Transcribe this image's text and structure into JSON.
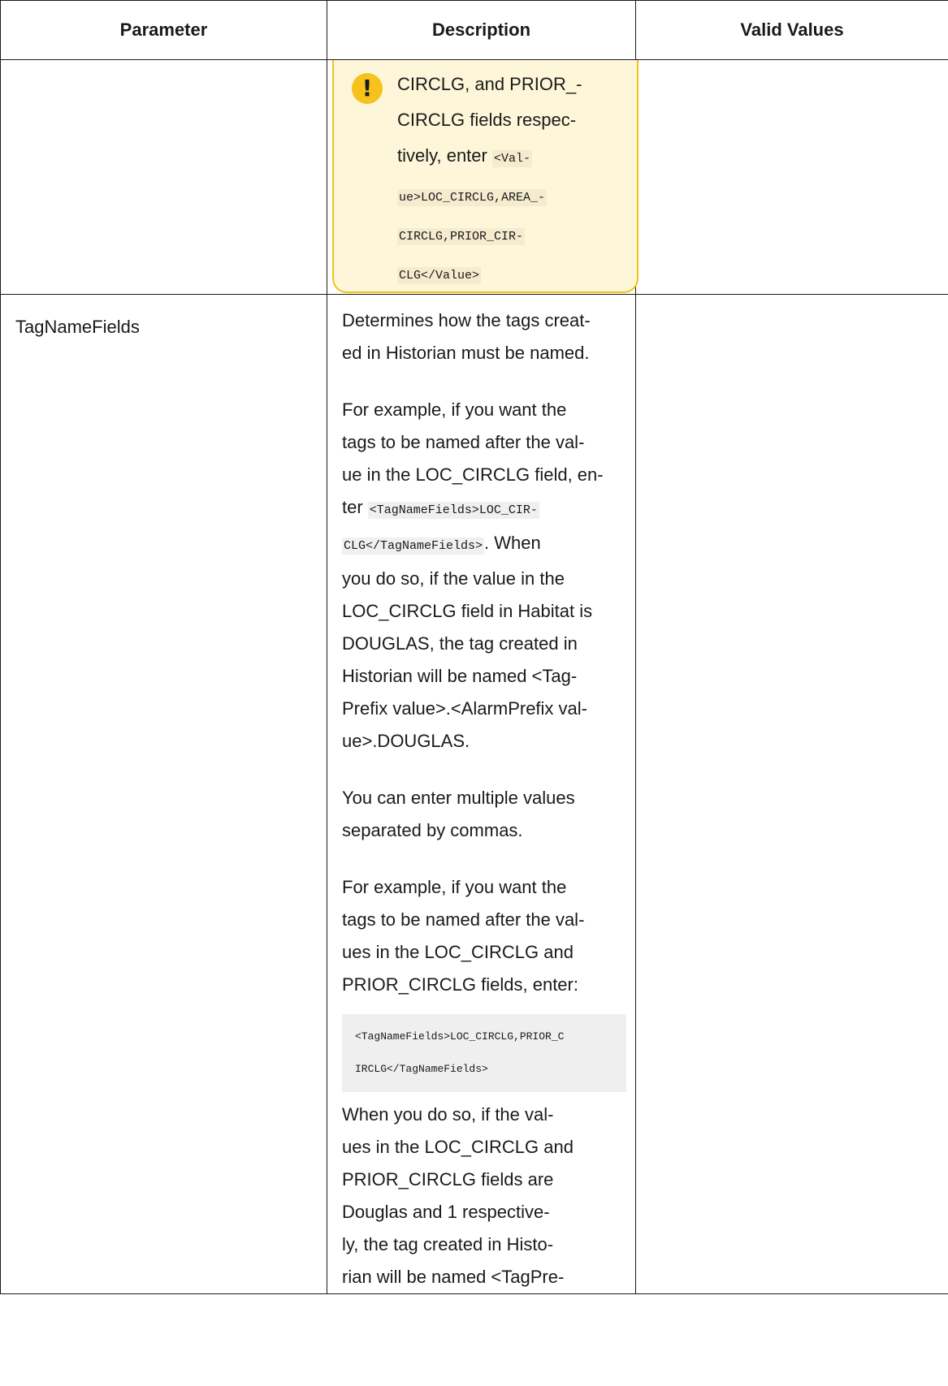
{
  "table": {
    "headers": {
      "parameter": "Parameter",
      "description": "Description",
      "valid_values": "Valid Values"
    },
    "note_row": {
      "icon": "exclamation-icon",
      "lines": [
        "CIRCLG, and PRIOR_-",
        "CIRCLG fields respec-"
      ],
      "line3_prefix": "tively, enter ",
      "code_lines": [
        "<Val-",
        "ue>LOC_CIRCLG,AREA_-",
        "CIRCLG,PRIOR_CIR-",
        "CLG</Value>"
      ]
    },
    "tagname_row": {
      "parameter": "TagNameFields",
      "p1_lines": [
        "Determines how the tags creat-",
        "ed in Historian must be named."
      ],
      "p2_lines_before": [
        "For example, if you want the",
        "tags to be named after the val-",
        "ue in the LOC_CIRCLG field, en-"
      ],
      "p2_ter": "ter ",
      "p2_code1": "<TagNameFields>LOC_CIR-",
      "p2_code2": "CLG</TagNameFields>",
      "p2_after_code": ". When",
      "p2_lines_after": [
        "you do so, if the value in the",
        "LOC_CIRCLG field in Habitat is",
        "DOUGLAS, the tag created in",
        "Historian will be named <Tag-",
        "Prefix value>.<AlarmPrefix val-",
        "ue>.DOUGLAS."
      ],
      "p3_lines": [
        "You can enter multiple values",
        "separated by commas."
      ],
      "p4_lines": [
        "For example, if you want the",
        "tags to be named after the val-",
        "ues in the LOC_CIRCLG and",
        "PRIOR_CIRCLG fields, enter:"
      ],
      "codeblock_lines": [
        "<TagNameFields>LOC_CIRCLG,PRIOR_C",
        "IRCLG</TagNameFields>"
      ],
      "p5_lines": [
        "When you do so, if the val-",
        "ues in the LOC_CIRCLG and",
        "PRIOR_CIRCLG fields are",
        "Douglas and 1 respective-",
        "ly, the tag created in Histo-",
        "rian will be named <TagPre-"
      ]
    }
  }
}
